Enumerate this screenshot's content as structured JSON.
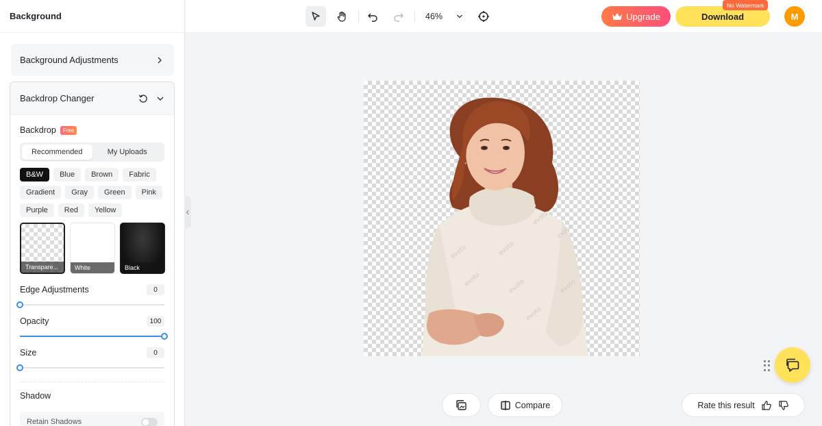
{
  "sidebar": {
    "title": "Background",
    "bg_adjustments": "Background Adjustments",
    "panel_title": "Backdrop Changer",
    "backdrop_label": "Backdrop",
    "free_badge": "Free",
    "tabs": [
      "Recommended",
      "My Uploads"
    ],
    "categories": [
      "B&W",
      "Blue",
      "Brown",
      "Fabric",
      "Gradient",
      "Gray",
      "Green",
      "Pink",
      "Purple",
      "Red",
      "Yellow"
    ],
    "active_category": "B&W",
    "swatches": [
      {
        "label": "Transpare..."
      },
      {
        "label": "White"
      },
      {
        "label": "Black"
      }
    ],
    "edge": {
      "label": "Edge Adjustments",
      "value": "0",
      "level": 0
    },
    "opacity": {
      "label": "Opacity",
      "value": "100",
      "level": 1
    },
    "size": {
      "label": "Size",
      "value": "0",
      "level": 0
    },
    "shadow_label": "Shadow",
    "retain_shadows": "Retain Shadows"
  },
  "toolbar": {
    "zoom": "46%",
    "upgrade": "Upgrade",
    "download": "Download",
    "no_watermark": "No Watermark",
    "avatar_initial": "M"
  },
  "bottom": {
    "compare": "Compare",
    "rate": "Rate this result"
  },
  "colors": {
    "accent": "#3a8ee6",
    "download_bg": "#ffe25a",
    "avatar_bg": "#ff9a00",
    "upgrade_start": "#ff7a45",
    "upgrade_end": "#ff4f7b"
  },
  "canvas": {
    "watermark": "evoto"
  }
}
